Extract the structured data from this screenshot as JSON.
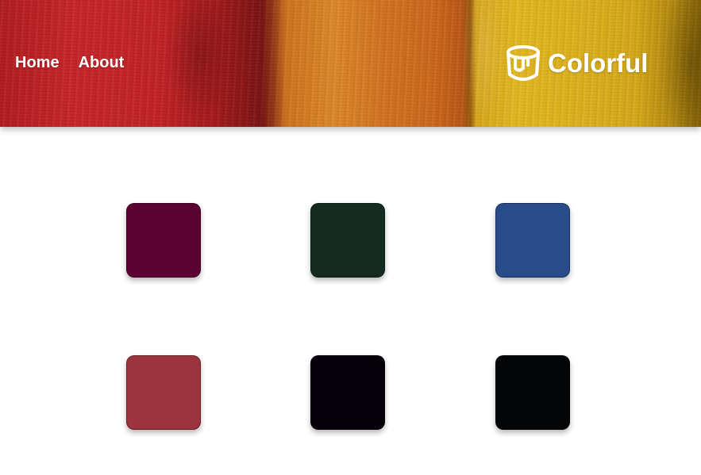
{
  "nav": {
    "home_label": "Home",
    "about_label": "About"
  },
  "brand": {
    "name": "Colorful",
    "icon": "paint-bucket-icon"
  },
  "swatches": [
    {
      "color": "#5c0233"
    },
    {
      "color": "#142c20"
    },
    {
      "color": "#294b89"
    },
    {
      "color": "#9b343c"
    },
    {
      "color": "#06000a"
    },
    {
      "color": "#040506"
    }
  ]
}
